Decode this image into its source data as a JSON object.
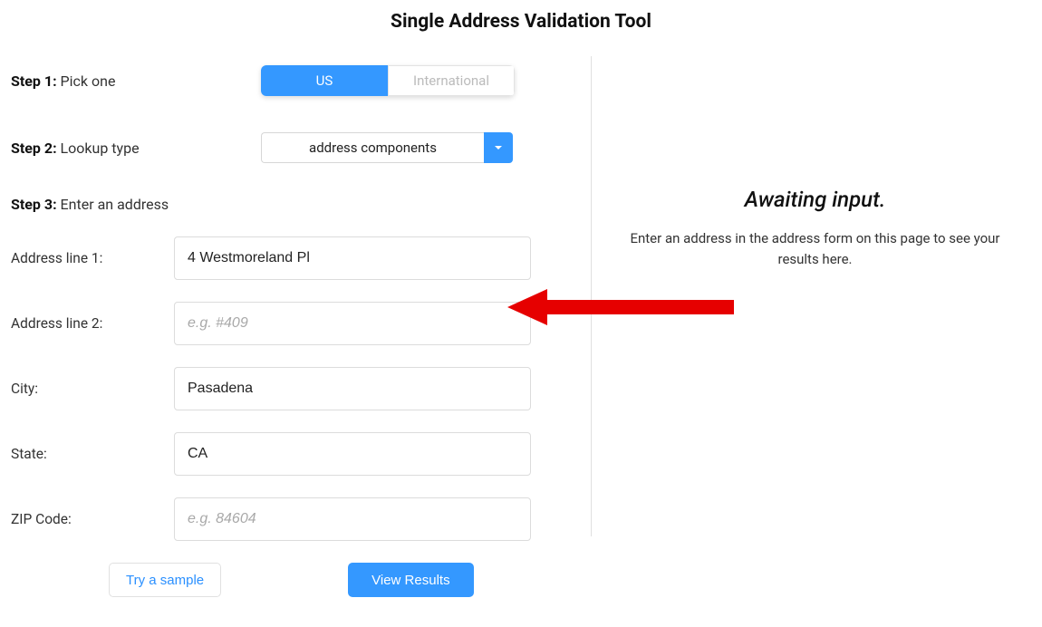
{
  "title": "Single Address Validation Tool",
  "steps": {
    "s1_label_bold": "Step 1:",
    "s1_label_text": " Pick one",
    "s1_toggle": {
      "us": "US",
      "intl": "International"
    },
    "s2_label_bold": "Step 2:",
    "s2_label_text": " Lookup type",
    "s2_select_value": "address components",
    "s3_label_bold": "Step 3:",
    "s3_label_text": " Enter an address"
  },
  "form": {
    "addr1": {
      "label": "Address line 1:",
      "value": "4 Westmoreland Pl"
    },
    "addr2": {
      "label": "Address line 2:",
      "placeholder": "e.g. #409",
      "value": ""
    },
    "city": {
      "label": "City:",
      "value": "Pasadena"
    },
    "state": {
      "label": "State:",
      "value": "CA"
    },
    "zip": {
      "label": "ZIP Code:",
      "placeholder": "e.g. 84604",
      "value": ""
    }
  },
  "actions": {
    "sample": "Try a sample",
    "view": "View Results"
  },
  "right": {
    "await_title": "Awaiting input.",
    "await_sub": "Enter an address in the address form on this page to see your results here."
  },
  "colors": {
    "accent": "#3498ff",
    "arrow": "#e60000"
  }
}
